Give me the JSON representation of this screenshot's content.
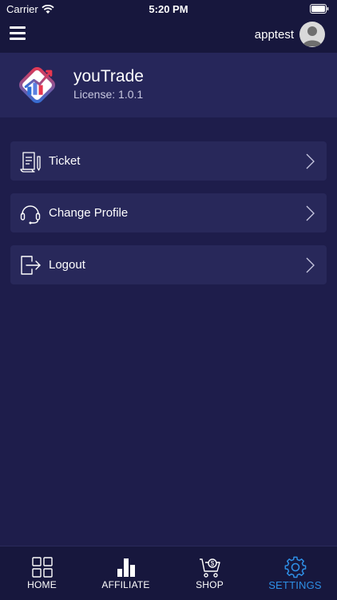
{
  "status_bar": {
    "carrier": "Carrier",
    "time": "5:20 PM"
  },
  "top_bar": {
    "username": "apptest"
  },
  "app": {
    "name": "youTrade",
    "license": "License: 1.0.1"
  },
  "menu": {
    "items": [
      {
        "label": "Ticket",
        "icon": "ticket-icon"
      },
      {
        "label": "Change Profile",
        "icon": "headset-icon"
      },
      {
        "label": "Logout",
        "icon": "logout-icon"
      }
    ]
  },
  "tabs": [
    {
      "label": "HOME",
      "icon": "grid-icon"
    },
    {
      "label": "AFFILIATE",
      "icon": "bar-chart-icon"
    },
    {
      "label": "SHOP",
      "icon": "cart-icon"
    },
    {
      "label": "SETTINGS",
      "icon": "gear-icon",
      "active": true
    }
  ],
  "colors": {
    "background": "#1e1d4b",
    "header": "#26265a",
    "accent": "#2e8fe6"
  }
}
